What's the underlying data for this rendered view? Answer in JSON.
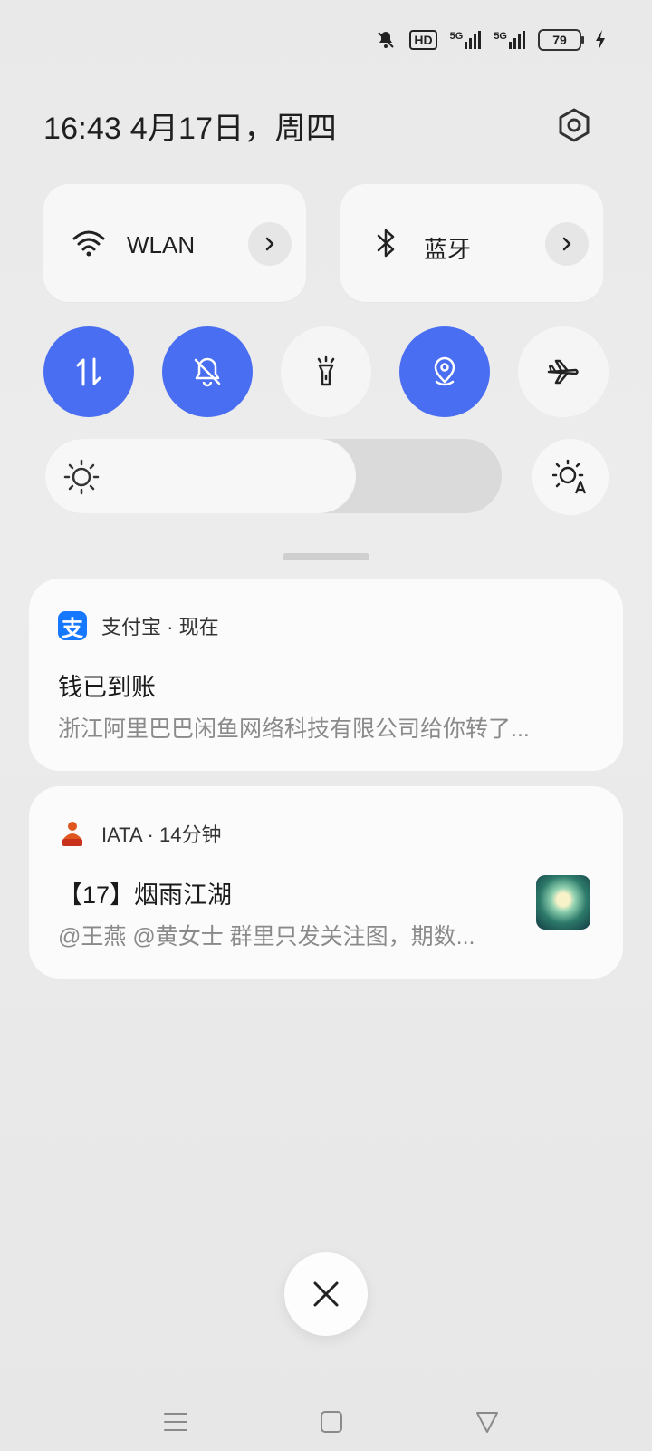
{
  "status_bar": {
    "icons": [
      "bell-muted-icon",
      "hd-icon",
      "signal-5g-icon",
      "signal-5g-icon",
      "battery-icon",
      "charging-icon"
    ],
    "hd_label": "HD",
    "net1_label": "5G",
    "net2_label": "5G",
    "battery_level": "79"
  },
  "header": {
    "datetime": "16:43  4月17日，周四",
    "settings_icon": "gear-icon"
  },
  "tiles": {
    "wlan": {
      "label": "WLAN",
      "icon": "wifi-icon"
    },
    "bluetooth": {
      "label": "蓝牙",
      "icon": "bluetooth-icon"
    }
  },
  "toggles": [
    {
      "name": "mobile-data",
      "icon": "data-arrows-icon",
      "on": true
    },
    {
      "name": "silent",
      "icon": "bell-off-icon",
      "on": true
    },
    {
      "name": "flashlight",
      "icon": "flashlight-icon",
      "on": false
    },
    {
      "name": "location",
      "icon": "location-icon",
      "on": true
    },
    {
      "name": "airplane",
      "icon": "airplane-icon",
      "on": false
    }
  ],
  "brightness": {
    "level": 0.68,
    "icon": "sun-icon",
    "auto_icon": "auto-brightness-icon"
  },
  "notifications": [
    {
      "app": "支付宝",
      "time": "现在",
      "title": "钱已到账",
      "body": "浙江阿里巴巴闲鱼网络科技有限公司给你转了..."
    },
    {
      "app": "IATA",
      "time": "14分钟",
      "title": "【17】烟雨江湖",
      "body": "@王燕 @黄女士 群里只发关注图，期数..."
    }
  ],
  "colors": {
    "accent": "#4a6ef1",
    "alipay": "#1677ff"
  },
  "alipay_glyph": "支"
}
